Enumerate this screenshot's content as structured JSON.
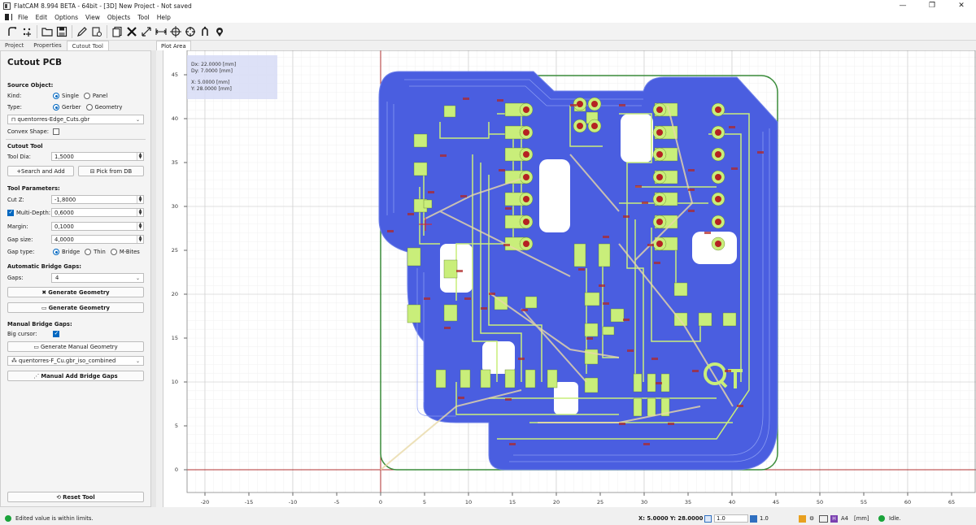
{
  "window": {
    "title": "FlatCAM 8.994 BETA - 64bit - [3D]   New Project - Not saved",
    "min": "—",
    "max": "❐",
    "close": "✕"
  },
  "menu": [
    "File",
    "Edit",
    "Options",
    "View",
    "Objects",
    "Tool",
    "Help"
  ],
  "toolbar": [
    "new-geometry-icon",
    "new-excellon-icon",
    "open-folder-icon",
    "save-icon",
    "edit-pencil-icon",
    "edit-paste-icon",
    "copy-icon",
    "delete-x-icon",
    "distance-icon",
    "distance-min-icon",
    "origin-icon",
    "jump-to-icon",
    "locate-icon",
    "replot-icon",
    "clear-plot-icon"
  ],
  "tabs": {
    "project": "Project",
    "properties": "Properties",
    "cutout": "Cutout Tool",
    "plot": "Plot Area"
  },
  "panel": {
    "title": "Cutout PCB",
    "source_title": "Source Object:",
    "kind_label": "Kind:",
    "kind_single": "Single",
    "kind_panel": "Panel",
    "type_label": "Type:",
    "type_gerber": "Gerber",
    "type_geometry": "Geometry",
    "source_file": "quentorres-Edge_Cuts.gbr",
    "convex_label": "Convex Shape:",
    "cutout_tool_title": "Cutout Tool",
    "tool_dia_label": "Tool Dia:",
    "tool_dia": "1,5000",
    "search_add": "Search and Add",
    "pick_db": "Pick from DB",
    "params_title": "Tool Parameters:",
    "cutz_label": "Cut Z:",
    "cutz": "-1,8000",
    "multidepth_label": "Multi-Depth:",
    "multidepth": "0,6000",
    "margin_label": "Margin:",
    "margin": "0,1000",
    "gapsize_label": "Gap size:",
    "gapsize": "4,0000",
    "gaptype_label": "Gap type:",
    "gap_bridge": "Bridge",
    "gap_thin": "Thin",
    "gap_mbites": "M-Bites",
    "auto_title": "Automatic Bridge Gaps:",
    "gaps_label": "Gaps:",
    "gaps": "4",
    "gen_geom_1": "Generate Geometry",
    "gen_geom_2": "Generate Geometry",
    "manual_title": "Manual Bridge Gaps:",
    "bigcursor_label": "Big cursor:",
    "gen_manual": "Generate Manual Geometry",
    "manual_source": "quentorres-F_Cu.gbr_iso_combined",
    "manual_add": "Manual Add Bridge Gaps",
    "reset": "Reset Tool"
  },
  "overlay": {
    "dx": "Dx:    22.0000 [mm]",
    "dy": "Dy:    7.0000 [mm]",
    "x": "X:     5.0000 [mm]",
    "y": "Y:     28.0000 [mm]"
  },
  "axes": {
    "x_ticks": [
      "-20",
      "-15",
      "-10",
      "-5",
      "0",
      "5",
      "10",
      "15",
      "20",
      "25",
      "30",
      "35",
      "40",
      "45",
      "50",
      "55",
      "60",
      "65"
    ],
    "y_ticks": [
      "45",
      "40",
      "35",
      "30",
      "25",
      "20",
      "15",
      "10",
      "5",
      "0"
    ]
  },
  "colors": {
    "copper_iso": "#4a5ee0",
    "pad": "#c9ee7a",
    "outline": "#2f8a2f",
    "drill": "#b52222",
    "annot": "#b02828"
  },
  "status": {
    "message": "Edited value is within limits.",
    "coords": "X: 5.0000  Y: 28.0000",
    "grid_x": "1.0",
    "grid_y": "1.0",
    "page": "A4",
    "units": "[mm]",
    "state": "Idle."
  }
}
